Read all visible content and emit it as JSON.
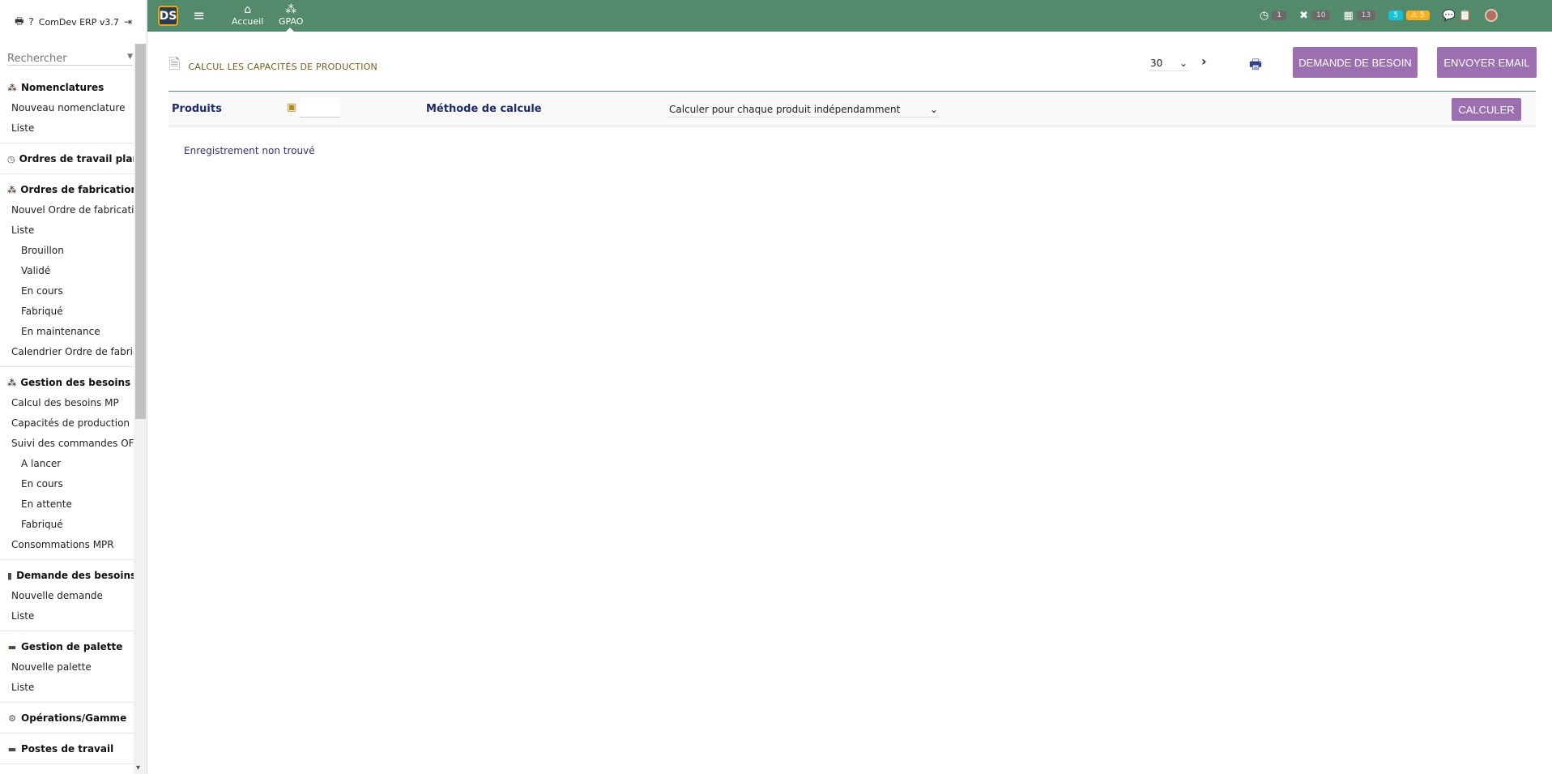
{
  "left": {
    "app_name": "ComDev ERP v3.7",
    "search_placeholder": "Rechercher",
    "groups": [
      {
        "title": "Nomenclatures",
        "icon": "sitemap-icon",
        "items": [
          {
            "label": "Nouveau nomenclature",
            "sub": false
          },
          {
            "label": "Liste",
            "sub": false
          }
        ]
      },
      {
        "title": "Ordres de travail planifiés",
        "icon": "clock-icon",
        "items": []
      },
      {
        "title": "Ordres de fabrication",
        "icon": "cubes-icon",
        "items": [
          {
            "label": "Nouvel Ordre de fabrication",
            "sub": false
          },
          {
            "label": "Liste",
            "sub": false
          },
          {
            "label": "Brouillon",
            "sub": true
          },
          {
            "label": "Validé",
            "sub": true
          },
          {
            "label": "En cours",
            "sub": true
          },
          {
            "label": "Fabriqué",
            "sub": true
          },
          {
            "label": "En maintenance",
            "sub": true
          },
          {
            "label": "Calendrier Ordre de fabrication",
            "sub": false
          }
        ]
      },
      {
        "title": "Gestion des besoins et capacités",
        "icon": "cubes-icon",
        "items": [
          {
            "label": "Calcul des besoins MP",
            "sub": false
          },
          {
            "label": "Capacités de production",
            "sub": false
          },
          {
            "label": "Suivi des commandes OFs",
            "sub": false
          },
          {
            "label": "A lancer",
            "sub": true
          },
          {
            "label": "En cours",
            "sub": true
          },
          {
            "label": "En attente",
            "sub": true
          },
          {
            "label": "Fabriqué",
            "sub": true
          },
          {
            "label": "Consommations MPR",
            "sub": false
          }
        ]
      },
      {
        "title": "Demande des besoins MP",
        "icon": "file-icon",
        "items": [
          {
            "label": "Nouvelle demande",
            "sub": false
          },
          {
            "label": "Liste",
            "sub": false
          }
        ]
      },
      {
        "title": "Gestion de palette",
        "icon": "pallet-icon",
        "items": [
          {
            "label": "Nouvelle palette",
            "sub": false
          },
          {
            "label": "Liste",
            "sub": false
          }
        ]
      },
      {
        "title": "Opérations/Gamme",
        "icon": "gear-icon",
        "items": []
      },
      {
        "title": "Postes de travail",
        "icon": "workstation-icon",
        "items": []
      }
    ]
  },
  "topbar": {
    "logo_text": "DS",
    "nav": [
      {
        "label": "Accueil",
        "icon": "home-icon"
      },
      {
        "label": "GPAO",
        "icon": "cubes-icon"
      }
    ],
    "badges": {
      "clock": "1",
      "tools": "10",
      "calendar": "13",
      "info": "5",
      "warning": "5"
    },
    "colors": {
      "bar": "#548a6c",
      "cyan": "#17c2d8",
      "yellow": "#f6b026"
    }
  },
  "main": {
    "title": "CALCUL LES CAPACITÉS DE PRODUCTION",
    "per_page": "30",
    "buttons": {
      "demande": "DEMANDE DE BESOIN",
      "email": "ENVOYER EMAIL",
      "calculer": "CALCULER"
    },
    "form": {
      "produits_label": "Produits",
      "methode_label": "Méthode de calcule",
      "methode_value": "Calculer pour chaque produit indépendamment"
    },
    "empty_message": "Enregistrement non trouvé",
    "accent_color": "#9b6fb0"
  }
}
